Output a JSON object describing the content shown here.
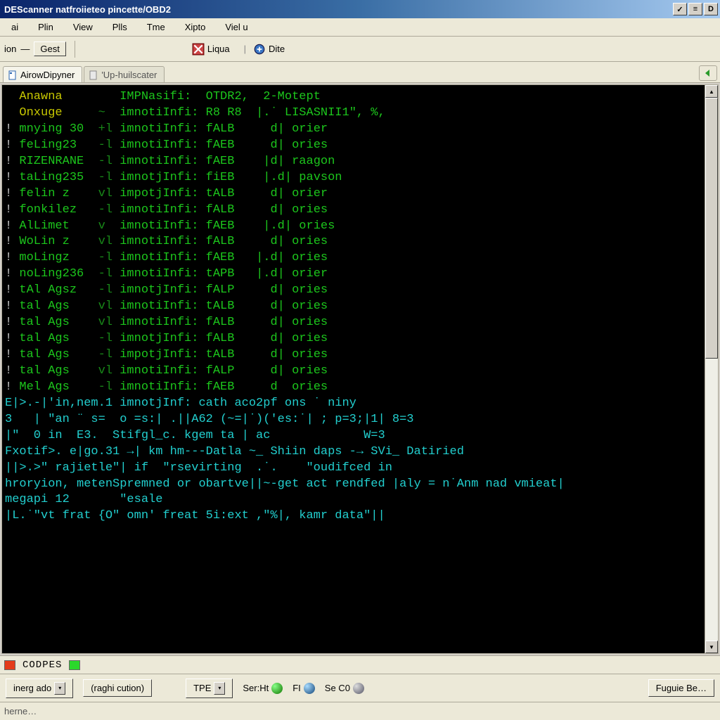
{
  "title": "DEScanner natfroiieteo pincette/OBD2",
  "window_buttons": [
    "✓",
    "≡",
    "D"
  ],
  "menu": [
    "ai",
    "Plin",
    "View",
    "Plls",
    "Tme",
    "Xipto",
    "Viel u"
  ],
  "toolbar": {
    "left": {
      "label": "ion",
      "dash": "—",
      "right": "Gest"
    },
    "liqua": "Liqua",
    "dite": "Dite"
  },
  "tabs": [
    {
      "label": "AirowDipyner",
      "active": true
    },
    {
      "label": "'Up-huilscater",
      "active": false
    }
  ],
  "terminal_rows": [
    [
      "",
      "Anawna",
      "",
      "IMPNasifi:",
      "OTDR2,",
      " 2-Motept"
    ],
    [
      "",
      "Onxuge",
      "~",
      "imnotiInfi:",
      "R8 R8",
      "|.˙ LISASNII1\", %,"
    ],
    [
      "!",
      "mnying 30",
      "+l",
      "imnotiInfi:",
      "fALB",
      "  d| orier"
    ],
    [
      "!",
      "feLing23",
      "-l",
      "imnotiInfi:",
      "fAEB",
      "  d| ories"
    ],
    [
      "!",
      "RIZENRANE",
      "-l",
      "imnotiInfi:",
      "fAEB",
      " |d| raagon"
    ],
    [
      "!",
      "taLing235",
      "-l",
      "imnotjInfi:",
      "fiEB",
      " |.d| pavson"
    ],
    [
      "!",
      "felin z",
      "vl",
      "impotjInfi:",
      "tALB",
      "  d| orier"
    ],
    [
      "!",
      "fonkilez",
      "-l",
      "imnotiInfi:",
      "fALB",
      "  d| ories"
    ],
    [
      "!",
      "AlLimet",
      "v",
      "imnotiInfi:",
      "fAEB",
      " |.d| ories"
    ],
    [
      "!",
      "WoLin z",
      "vl",
      "imnotiInfi:",
      "fALB",
      "  d| ories"
    ],
    [
      "!",
      "moLingz",
      "-l",
      "imnotiInfi:",
      "fAEB",
      "|.d| ories"
    ],
    [
      "!",
      "noLing236",
      "-l",
      "imnotiInfi:",
      "tAPB",
      "|.d| orier"
    ],
    [
      "!",
      "tAl Agsz",
      "-l",
      "imnotjInfi:",
      "fALP",
      "  d| ories"
    ],
    [
      "!",
      "tal Ags",
      "vl",
      "imnotiInfi:",
      "tALB",
      "  d| ories"
    ],
    [
      "!",
      "tal Ags",
      "vl",
      "imnotiInfi:",
      "fALB",
      "  d| ories"
    ],
    [
      "!",
      "tal Ags",
      "-l",
      "imnotjInfi:",
      "fALB",
      "  d| ories"
    ],
    [
      "!",
      "tal Ags",
      "-l",
      "impotjInfi:",
      "tALB",
      "  d| ories"
    ],
    [
      "!",
      "tal Ags",
      "vl",
      "imnotiInfi:",
      "fALP",
      "  d| ories"
    ],
    [
      "!",
      "Mel Ags",
      "-l",
      "imnotiInfi:",
      "fAEB",
      "  d  ories"
    ],
    [
      "",
      "E|>.-|'in,nem.1 imnotjInf: cath aco2pf ons ˙ niny",
      "",
      "",
      "",
      ""
    ],
    [
      "",
      "3   | \"an ¨ s=  o =s:| .||A62 (~=|˙)('es:˙| ; p=3;|1| 8=3",
      "",
      "",
      "",
      ""
    ],
    [
      "",
      "|\"  0 in  E3.  Stifgl_c. kgem ta | ac             W=3",
      "",
      "",
      "",
      ""
    ],
    [
      "",
      "Fxotif>. e|go.31 →| km hm---Datla ~_ Shiin daps -→ SVi_ Datiried",
      "",
      "",
      "",
      ""
    ],
    [
      "",
      "||>.>\" rajietle\"| if  \"rsevirting  .˙.    \"oudifced in",
      "",
      "",
      "",
      ""
    ],
    [
      "",
      "hroryion, metenSpremned or obartve||~-get act rendfed |aly = n˙Anm nad vmieat|",
      "",
      "",
      "",
      ""
    ],
    [
      "",
      "megapi 12       \"esale",
      "",
      "",
      "",
      ""
    ],
    [
      "",
      "|L.˙\"vt frat {O\" omn' freat 5i:ext ,\"%|, kamr data\"||",
      "",
      "",
      "",
      ""
    ]
  ],
  "status1": {
    "codpes": "CODPES"
  },
  "status2": {
    "inerg": "inerg ado",
    "raghi": "(raghi cution)",
    "tpe": "TPE",
    "serht": "Ser:Ht",
    "fi": "FI",
    "seco": "Se C0",
    "fugie": "Fuguie Be…"
  },
  "address": "herne…",
  "colors": {
    "term_fg": "#1cc61c",
    "term_bg": "#000000"
  }
}
